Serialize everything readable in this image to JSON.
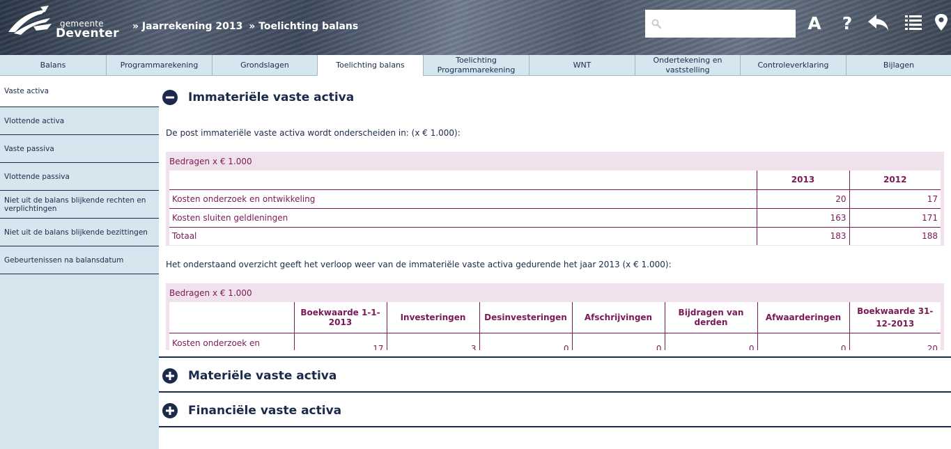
{
  "header": {
    "logo_line1": "gemeente",
    "logo_line2": "Deventer",
    "breadcrumb": [
      "» Jaarrekening 2013",
      "» Toelichting balans"
    ],
    "search_placeholder": ""
  },
  "tabs": [
    {
      "label": "Balans",
      "active": false
    },
    {
      "label": "Programmarekening",
      "active": false
    },
    {
      "label": "Grondslagen",
      "active": false
    },
    {
      "label": "Toelichting balans",
      "active": true
    },
    {
      "label": "Toelichting Programmarekening",
      "active": false
    },
    {
      "label": "WNT",
      "active": false
    },
    {
      "label": "Ondertekening en vaststelling",
      "active": false
    },
    {
      "label": "Controleverklaring",
      "active": false
    },
    {
      "label": "Bijlagen",
      "active": false
    }
  ],
  "sidebar": [
    {
      "label": "Vaste activa"
    },
    {
      "label": "Vlottende activa"
    },
    {
      "label": "Vaste passiva"
    },
    {
      "label": "Vlottende passiva"
    },
    {
      "label": "Niet uit de balans blijkende rechten en verplichtingen"
    },
    {
      "label": "Niet uit de balans blijkende bezittingen"
    },
    {
      "label": "Gebeurtenissen na balansdatum"
    }
  ],
  "sections": [
    {
      "title": "Immateriële vaste activa",
      "expanded": true
    },
    {
      "title": "Materiële vaste activa",
      "expanded": false
    },
    {
      "title": "Financiële vaste activa",
      "expanded": false
    }
  ],
  "intro_text": "De post immateriële vaste activa wordt onderscheiden in: (x € 1.000):",
  "table1": {
    "caption": "Bedragen x € 1.000",
    "headers": [
      "",
      "2013",
      "2012"
    ],
    "rows": [
      [
        "Kosten onderzoek en ontwikkeling",
        "20",
        "17"
      ],
      [
        "Kosten sluiten geldleningen",
        "163",
        "171"
      ],
      [
        "Totaal",
        "183",
        "188"
      ]
    ]
  },
  "mid_text": "Het onderstaand overzicht geeft het verloop weer van de immateriële vaste activa gedurende het jaar 2013 (x € 1.000):",
  "table2": {
    "caption": "Bedragen x € 1.000",
    "headers": [
      "",
      "Boekwaarde 1-1-2013",
      "Investeringen",
      "Desinvesteringen",
      "Afschrijvingen",
      "Bijdragen van derden",
      "Afwaarderingen",
      "Boekwaarde 31-12-2013"
    ],
    "rows": [
      [
        "Kosten onderzoek en ontwikkeling",
        "17",
        "3",
        "0",
        "0",
        "0",
        "0",
        "20"
      ]
    ]
  },
  "colors": {
    "navy": "#1b2a4a",
    "tab_bg": "#d5e6ef",
    "table_bg": "#f1e1ec",
    "table_text": "#7a1a55"
  }
}
